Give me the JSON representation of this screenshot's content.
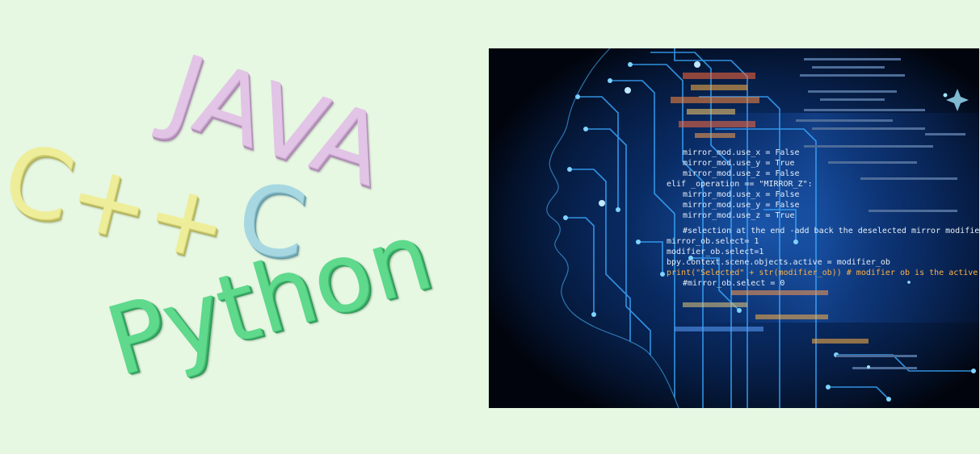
{
  "words": {
    "java": "JAVA",
    "cpp": "C++",
    "c": "C",
    "python": "Python"
  },
  "code_lines": [
    "mirror_mod.use_x = False",
    "mirror_mod.use_y = True",
    "mirror_mod.use_z = False",
    "elif _operation == \"MIRROR_Z\":",
    "mirror_mod.use_x = False",
    "mirror_mod.use_y = False",
    "mirror_mod.use_z = True",
    "#selection at the end -add back the deselected mirror modifier object",
    "mirror_ob.select= 1",
    "modifier_ob.select=1",
    "bpy.context.scene.objects.active = modifier_ob",
    "print(\"Selected\" + str(modifier_ob)) # modifier ob is the active ob",
    "#mirror_ob.select = 0"
  ],
  "colors": {
    "background": "#e6f7e2",
    "java": "#e2c4e6",
    "cpp": "#eeee9a",
    "c": "#a7d8e2",
    "python": "#5fd98c",
    "circuit": "#3aa8ff",
    "code_highlight": "#ffb347"
  }
}
